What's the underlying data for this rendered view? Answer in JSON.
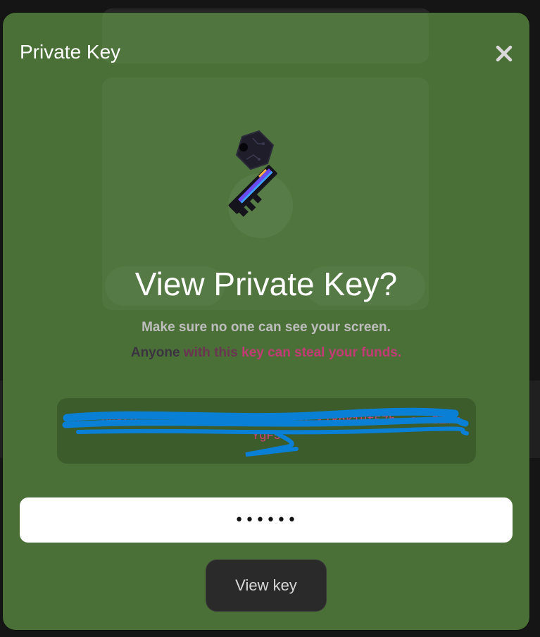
{
  "modal": {
    "title": "Private Key",
    "close_icon": "close-icon"
  },
  "illustration": {
    "icon": "key-icon"
  },
  "content": {
    "heading": "View Private Key?",
    "subtext": "Make sure no one can see your screen.",
    "warning_part1": "Anyone ",
    "warning_part2": "with this ",
    "warning_part3": "key can steal your funds."
  },
  "key_box": {
    "value": "3...ph8rb....................k451.ki8gk1Hf57b..e.u2ZmkYgF5",
    "redacted": true
  },
  "password": {
    "value": "••••••",
    "type": "password"
  },
  "actions": {
    "view_key_label": "View key"
  },
  "colors": {
    "modal_background": "#4a7037",
    "key_box_background": "#3c5c2c",
    "warning_accent": "#c33b74",
    "redaction": "#0a7fd6",
    "button_background": "#2a2a2a"
  }
}
